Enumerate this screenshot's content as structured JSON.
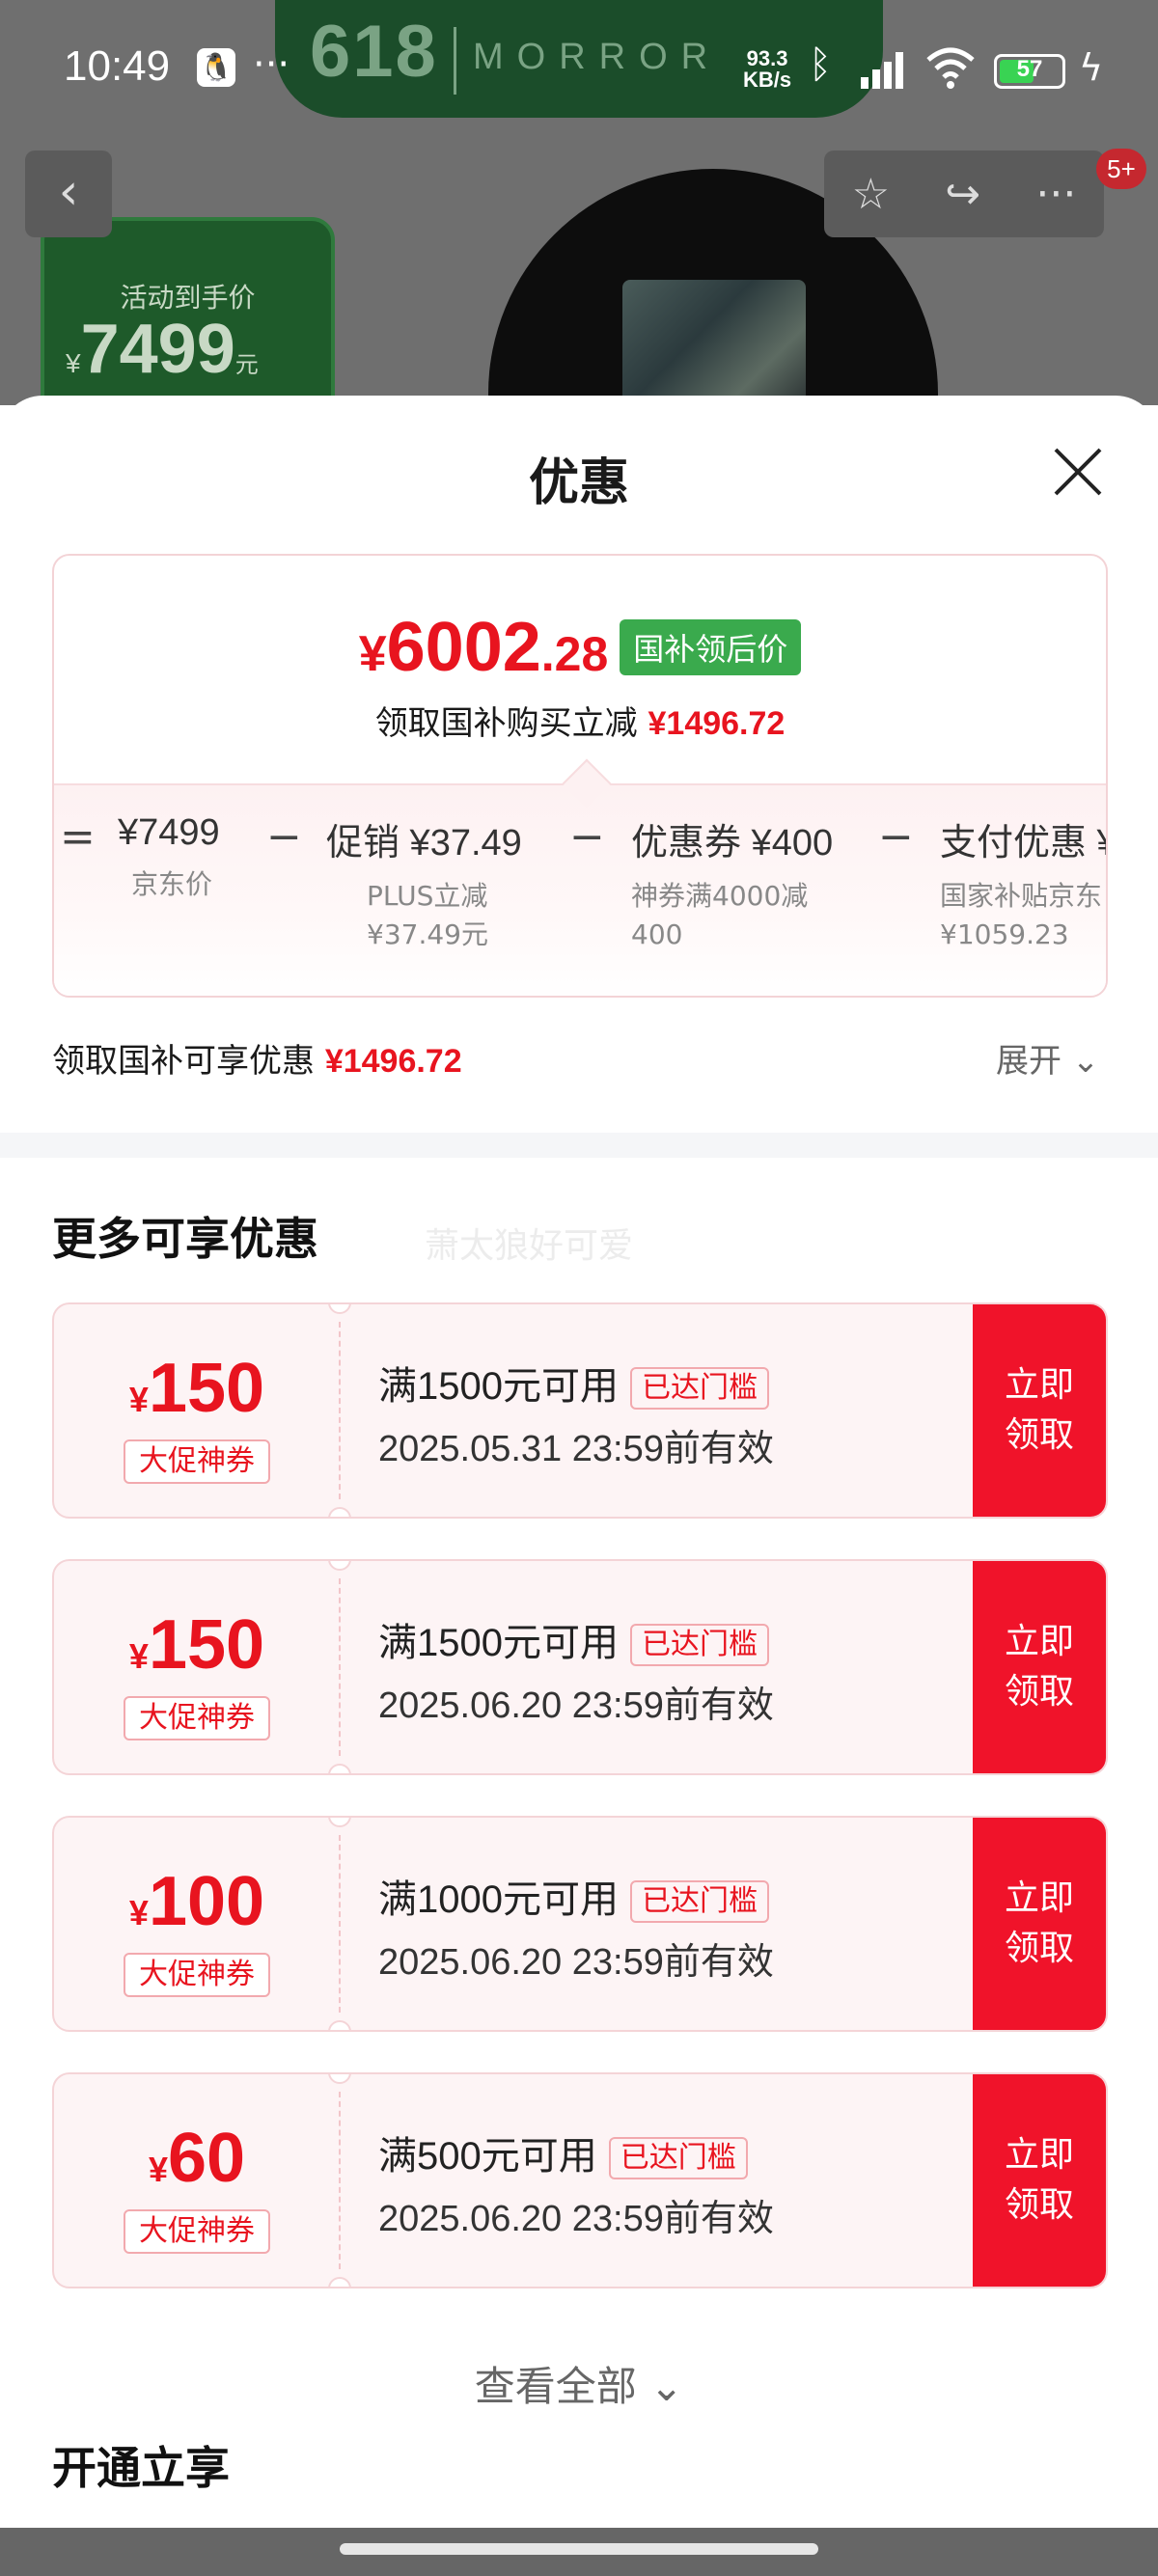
{
  "status_bar": {
    "time": "10:49",
    "dots": "···",
    "net_speed": "93.3",
    "net_unit": "KB/s",
    "battery": "57"
  },
  "background": {
    "banner_618": "618",
    "banner_brand": "MORROR",
    "badge_label": "活动到手价",
    "badge_currency": "¥",
    "badge_price": "7499",
    "badge_unit": "元"
  },
  "nav": {
    "badge": "5+"
  },
  "sheet": {
    "title": "优惠",
    "price": {
      "symbol": "¥",
      "integer": "6002",
      "decimal": ".28",
      "tag": "国补领后价",
      "sub_label": "领取国补购买立减",
      "sub_amount": "¥1496.72"
    },
    "breakdown": [
      {
        "op": "=",
        "top": "¥7499",
        "label": "京东价",
        "label2": ""
      },
      {
        "op": "−",
        "top": "促销 ¥37.49",
        "label": "PLUS立减",
        "label2": "¥37.49元"
      },
      {
        "op": "−",
        "top": "优惠券 ¥400",
        "label": "神券满4000减",
        "label2": "400"
      },
      {
        "op": "−",
        "top": "支付优惠 ¥",
        "label": "国家补贴京东",
        "label2": "¥1059.23"
      }
    ],
    "discount_line": {
      "label": "领取国补可享优惠",
      "amount": "¥1496.72",
      "expand": "展开 ⌄"
    },
    "more_title": "更多可享优惠",
    "watermark": "萧太狼好可爱",
    "coupons": [
      {
        "symbol": "¥",
        "value": "150",
        "type": "大促神券",
        "condition": "满1500元可用",
        "reach": "已达门槛",
        "valid": "2025.05.31 23:59前有效",
        "claim": "立即领取"
      },
      {
        "symbol": "¥",
        "value": "150",
        "type": "大促神券",
        "condition": "满1500元可用",
        "reach": "已达门槛",
        "valid": "2025.06.20 23:59前有效",
        "claim": "立即领取"
      },
      {
        "symbol": "¥",
        "value": "100",
        "type": "大促神券",
        "condition": "满1000元可用",
        "reach": "已达门槛",
        "valid": "2025.06.20 23:59前有效",
        "claim": "立即领取"
      },
      {
        "symbol": "¥",
        "value": "60",
        "type": "大促神券",
        "condition": "满500元可用",
        "reach": "已达门槛",
        "valid": "2025.06.20 23:59前有效",
        "claim": "立即领取"
      }
    ],
    "view_all": "查看全部 ⌄",
    "open_title": "开通立享"
  },
  "colors": {
    "accent_red": "#e8141f",
    "claim_red": "#f0132a",
    "tag_green": "#3aaa4d"
  }
}
